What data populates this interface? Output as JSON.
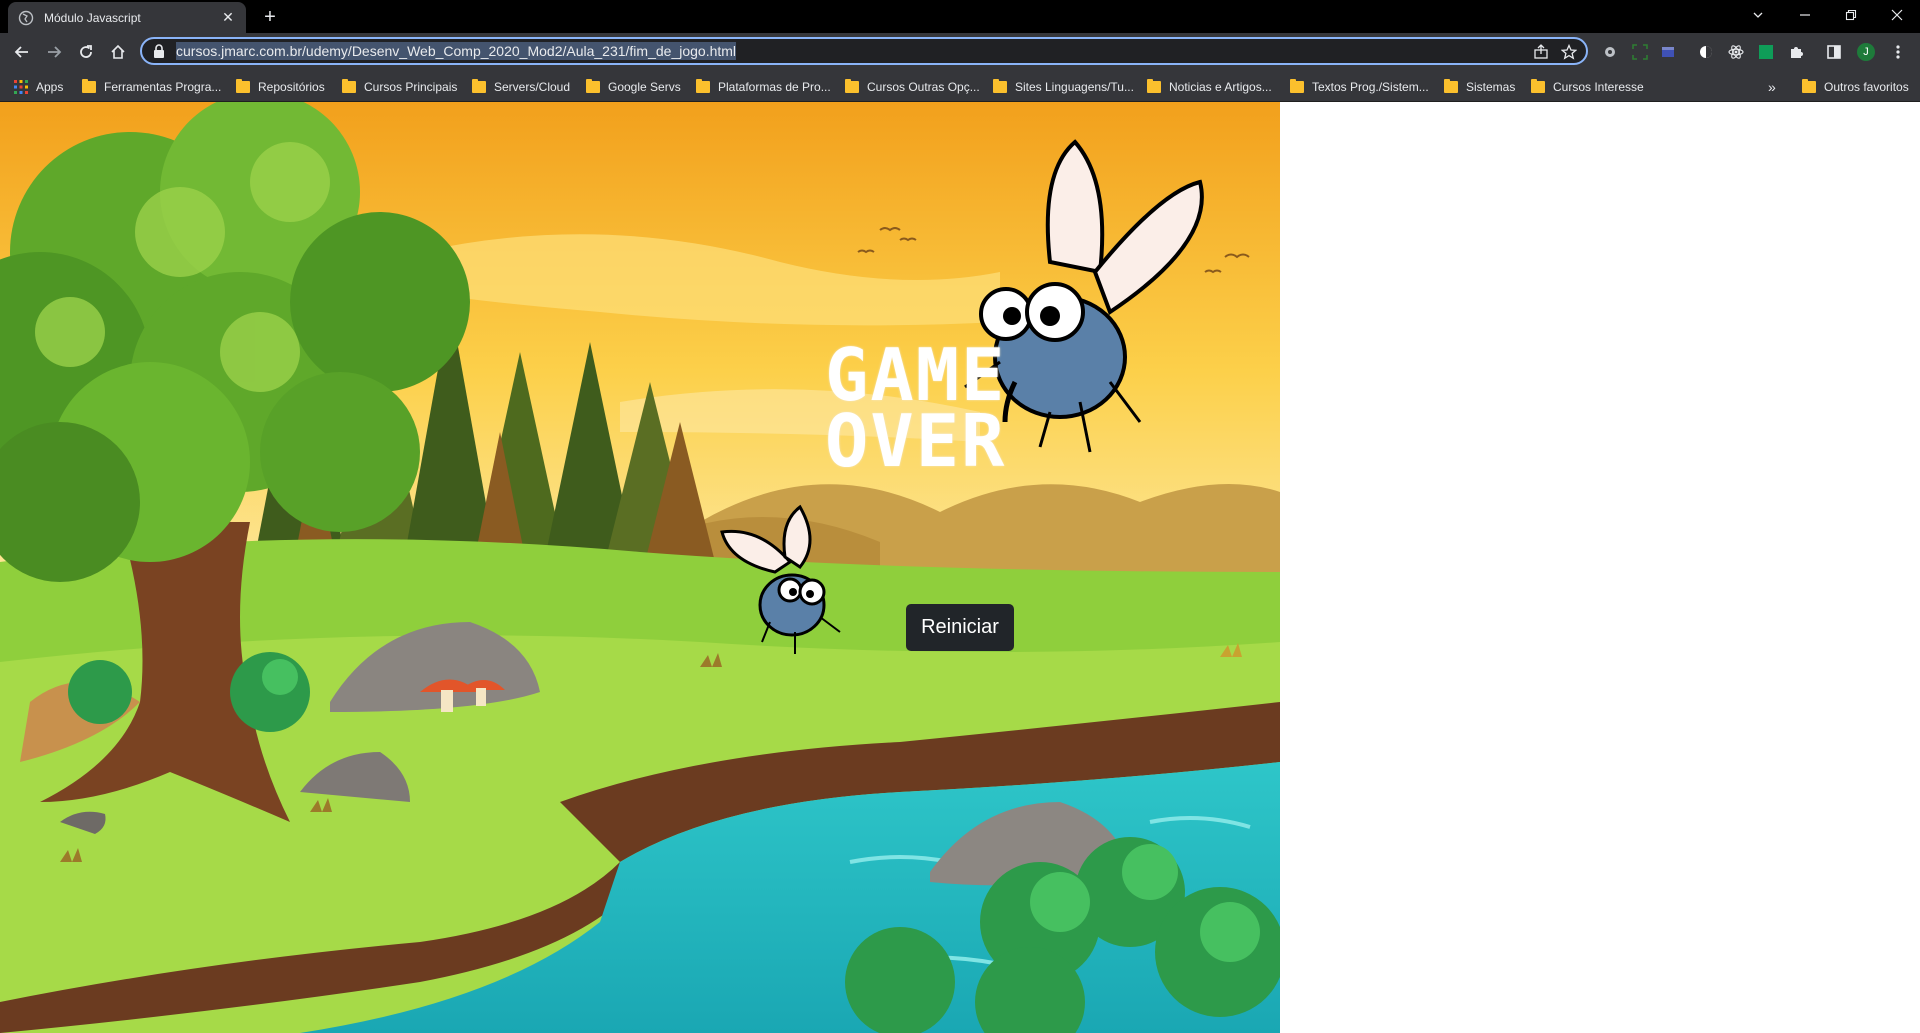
{
  "browser": {
    "tab_title": "Módulo Javascript",
    "url": "cursos.jmarc.com.br/udemy/Desenv_Web_Comp_2020_Mod2/Aula_231/fim_de_jogo.html",
    "bookmarks": [
      "Apps",
      "Ferramentas Progra...",
      "Repositórios",
      "Cursos Principais",
      "Servers/Cloud",
      "Google Servs",
      "Plataformas de Pro...",
      "Cursos Outras Opç...",
      "Sites Linguagens/Tu...",
      "Noticias e Artigos...",
      "Textos Prog./Sistem...",
      "Sistemas",
      "Cursos Interesse"
    ],
    "overflow_label": "»",
    "other_bookmarks": "Outros favoritos",
    "profile_initial": "J"
  },
  "game": {
    "title_line1": "GAME",
    "title_line2": "OVER",
    "restart_label": "Reiniciar"
  },
  "colors": {
    "button_bg": "#212529",
    "omnibox_focus": "#8ab4f8",
    "chrome_bg": "#35363a"
  }
}
